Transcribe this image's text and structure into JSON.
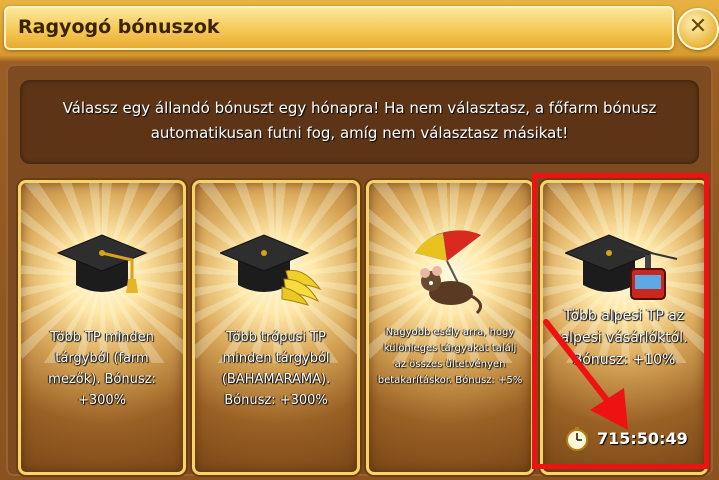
{
  "window": {
    "title": "Ragyogó bónuszok",
    "close_icon": "close-icon",
    "close_glyph": "✕"
  },
  "intro": {
    "text": "Válassz egy állandó bónuszt egy hónapra! Ha nem választasz, a főfarm bónusz automatikusan futni fog, amíg nem választasz másikat!"
  },
  "cards": [
    {
      "icon": "graduation-cap-icon",
      "text": "Több TP minden tárgyból (farm mezők). Bónusz: +300%"
    },
    {
      "icon": "graduation-cap-banana-icon",
      "text": "Több trópusi TP minden tárgyból (BAHAMARAMA). Bónusz: +300%"
    },
    {
      "icon": "mouse-umbrella-icon",
      "text": "Nagyobb esély arra, hogy különleges tárgyakat találj az összes ültetvényen betakarításkor. Bónusz: +5%"
    },
    {
      "icon": "graduation-cap-cable-car-icon",
      "text": "Több alpesi TP az alpesi vásárlóktól. Bónusz: +10%",
      "timer": "715:50:49",
      "timer_icon": "stopwatch-icon"
    }
  ],
  "annotation": {
    "highlight_color": "#ee1212",
    "arrow_icon": "red-arrow-icon"
  }
}
